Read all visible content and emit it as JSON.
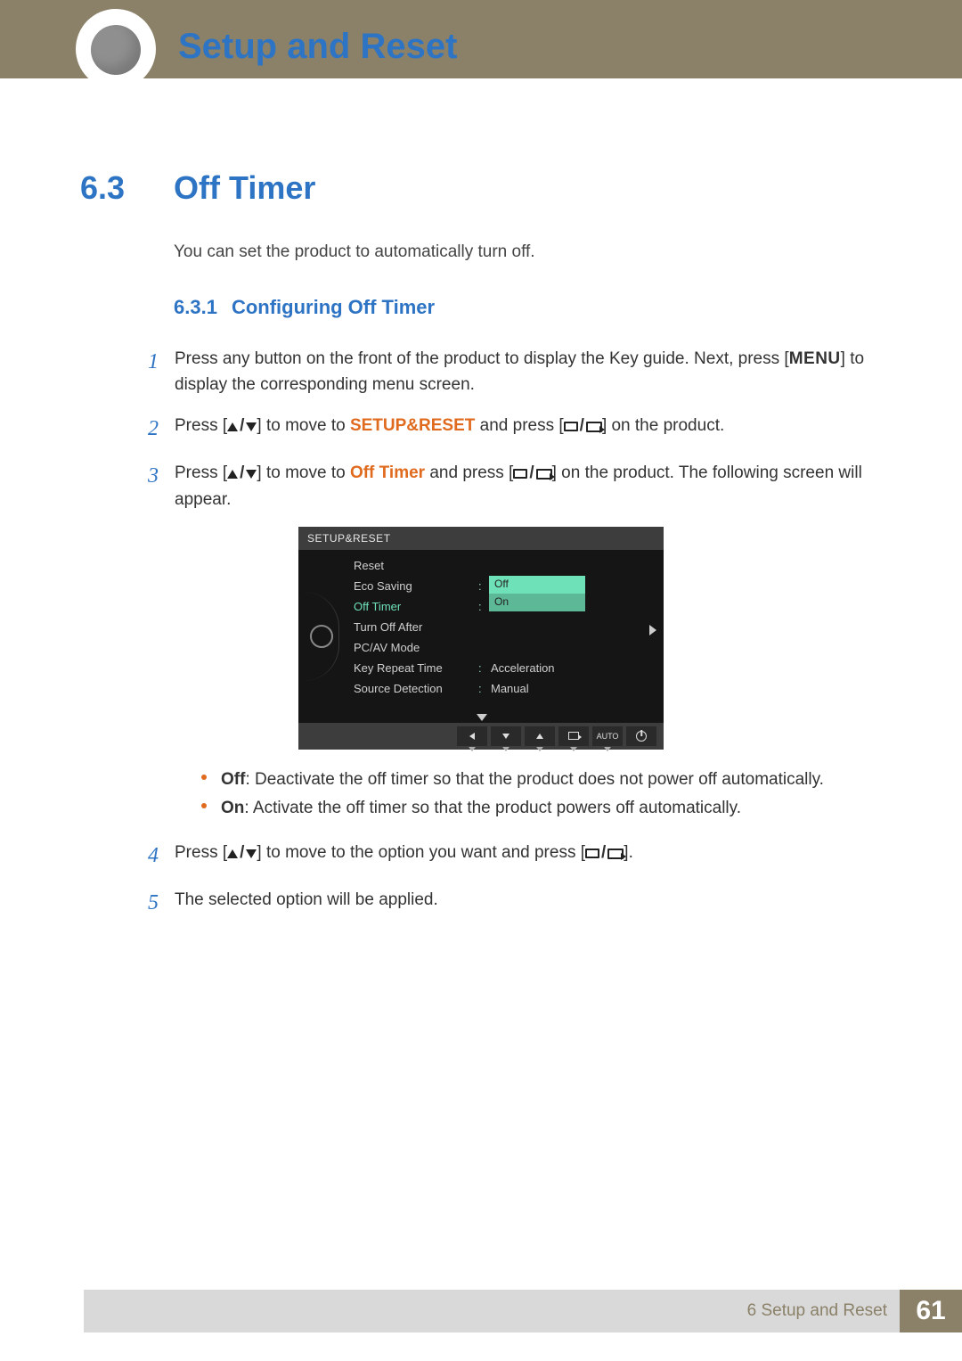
{
  "header": {
    "chapter_title": "Setup and Reset"
  },
  "section": {
    "number": "6.3",
    "title": "Off Timer"
  },
  "intro": "You can set the product to automatically turn off.",
  "subsection": {
    "number": "6.3.1",
    "title": "Configuring Off Timer"
  },
  "steps": {
    "s1": {
      "n": "1",
      "pre": "Press any button on the front of the product to display the Key guide. Next, press [",
      "menu": "MENU",
      "post": "] to display the corresponding menu screen."
    },
    "s2": {
      "n": "2",
      "pre": "Press [",
      "mid": "] to move to ",
      "kw": "SETUP&RESET",
      "mid2": " and press [",
      "post": "] on the product."
    },
    "s3": {
      "n": "3",
      "pre": "Press [",
      "mid": "] to move to ",
      "kw": "Off Timer",
      "mid2": " and press [",
      "post": "] on the product. The following screen will appear."
    },
    "s4": {
      "n": "4",
      "pre": "Press [",
      "mid": "] to move to the option you want and press [",
      "post": "]."
    },
    "s5": {
      "n": "5",
      "text": "The selected option will be applied."
    }
  },
  "bullets": {
    "off": {
      "hl": "Off",
      "text": ": Deactivate the off timer so that the product does not power off automatically."
    },
    "on": {
      "hl": "On",
      "text": ": Activate the off timer so that the product powers off automatically."
    }
  },
  "osd": {
    "title": "SETUP&RESET",
    "rows": {
      "reset": "Reset",
      "eco": "Eco Saving",
      "eco_val": "Off",
      "off_timer": "Off Timer",
      "turn_off": "Turn Off After",
      "pcav": "PC/AV Mode",
      "keyrep": "Key Repeat Time",
      "keyrep_val": "Acceleration",
      "srcdet": "Source Detection",
      "srcdet_val": "Manual"
    },
    "options": {
      "off": "Off",
      "on": "On"
    },
    "footer": {
      "auto": "AUTO"
    }
  },
  "footer": {
    "chapter": "6 Setup and Reset",
    "page": "61"
  }
}
